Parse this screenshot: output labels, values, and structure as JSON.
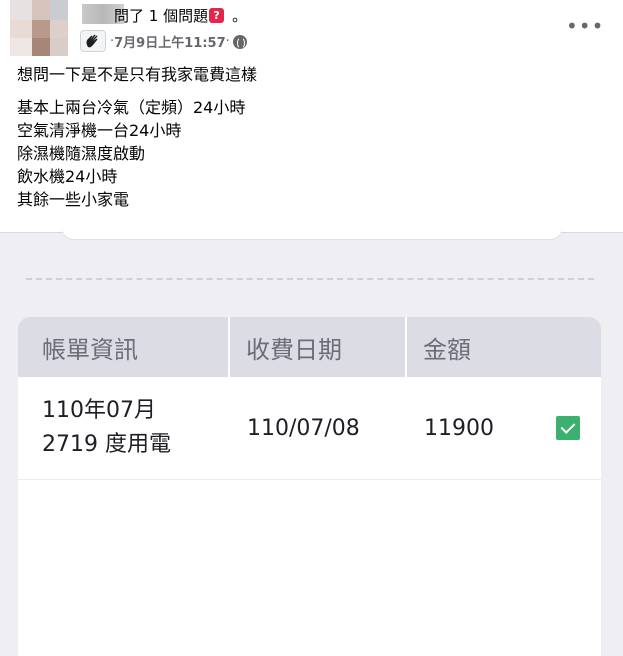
{
  "post": {
    "author_suffix": "問了 1 個問題",
    "question_badge": "?",
    "trailing_dot": "。",
    "timestamp": "7月9日上午11:57",
    "separator_before": "·",
    "separator_after": "·",
    "privacy_icon": "globe-icon",
    "group_icon": "hand-wave-icon",
    "more_icon": "•••",
    "lines": {
      "l1": "想問一下是不是只有我家電費這樣",
      "l2": "基本上兩台冷氣（定頻）24小時",
      "l3": "空氣清淨機一台24小時",
      "l4": "除濕機隨濕度啟動",
      "l5": "飲水機24小時",
      "l6": "其餘一些小家電"
    }
  },
  "bill_table": {
    "headers": {
      "info": "帳單資訊",
      "date": "收費日期",
      "amount": "金額"
    },
    "row": {
      "period": "110年07月",
      "usage": "2719 度用電",
      "date": "110/07/08",
      "amount": "11900",
      "status_icon": "check-icon",
      "status_color": "#3cb06e"
    }
  },
  "colors": {
    "badge": "#e4264b",
    "meta_text": "#65676b",
    "table_header_bg": "#dcdce4"
  }
}
